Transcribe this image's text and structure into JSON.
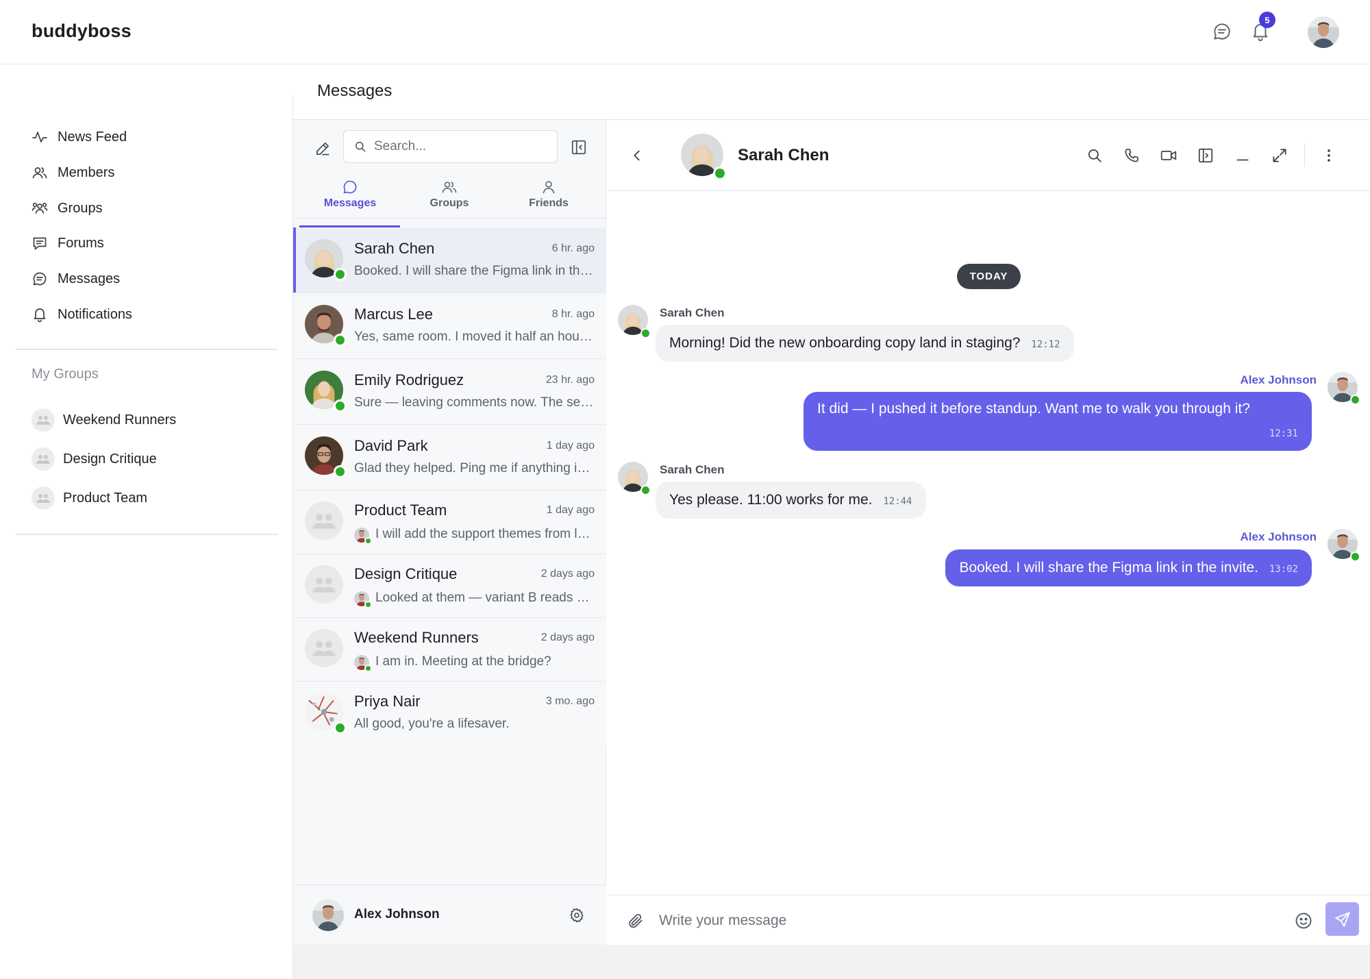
{
  "app": {
    "logo": "buddyboss"
  },
  "topbar": {
    "notification_count": "5"
  },
  "nav": {
    "items": [
      {
        "label": "News Feed",
        "icon": "activity-icon"
      },
      {
        "label": "Members",
        "icon": "members-icon"
      },
      {
        "label": "Groups",
        "icon": "groups-icon"
      },
      {
        "label": "Forums",
        "icon": "forums-icon"
      },
      {
        "label": "Messages",
        "icon": "messages-icon"
      },
      {
        "label": "Notifications",
        "icon": "bell-icon"
      }
    ],
    "my_groups_title": "My Groups",
    "groups": [
      {
        "label": "Weekend Runners"
      },
      {
        "label": "Design Critique"
      },
      {
        "label": "Product Team"
      }
    ]
  },
  "messages_page": {
    "title": "Messages"
  },
  "conv_panel": {
    "search_placeholder": "Search...",
    "tabs": [
      {
        "label": "Messages",
        "active": true
      },
      {
        "label": "Groups",
        "active": false
      },
      {
        "label": "Friends",
        "active": false
      }
    ],
    "conversations": [
      {
        "name": "Sarah Chen",
        "time": "6 hr. ago",
        "preview": "Booked. I will share the Figma link in the invite.",
        "selected": true,
        "kind": "person",
        "online": true
      },
      {
        "name": "Marcus Lee",
        "time": "8 hr. ago",
        "preview": "Yes, same room. I moved it half an hour later.",
        "selected": false,
        "kind": "person",
        "online": true
      },
      {
        "name": "Emily Rodriguez",
        "time": "23 hr. ago",
        "preview": "Sure — leaving comments now. The second section needs work.",
        "selected": false,
        "kind": "person",
        "online": true
      },
      {
        "name": "David Park",
        "time": "1 day ago",
        "preview": "Glad they helped. Ping me if anything is unclear.",
        "selected": false,
        "kind": "person",
        "online": true
      },
      {
        "name": "Product Team",
        "time": "1 day ago",
        "preview": "I will add the support themes from last week.",
        "selected": false,
        "kind": "group"
      },
      {
        "name": "Design Critique",
        "time": "2 days ago",
        "preview": "Looked at them — variant B reads cleaner to me.",
        "selected": false,
        "kind": "group"
      },
      {
        "name": "Weekend Runners",
        "time": "2 days ago",
        "preview": "I am in. Meeting at the bridge?",
        "selected": false,
        "kind": "group"
      },
      {
        "name": "Priya Nair",
        "time": "3 mo. ago",
        "preview": "All good, you're a lifesaver.",
        "selected": false,
        "kind": "person",
        "online": true
      }
    ],
    "self_name": "Alex Johnson"
  },
  "chat": {
    "title": "Sarah Chen",
    "day_label": "TODAY",
    "messages": [
      {
        "sender": "Sarah Chen",
        "text": "Morning! Did the new onboarding copy land in staging?",
        "time": "12:12",
        "mine": false
      },
      {
        "sender": "Alex Johnson",
        "text": "It did — I pushed it before standup. Want me to walk you through it?",
        "time": "12:31",
        "mine": true
      },
      {
        "sender": "Sarah Chen",
        "text": "Yes please. 11:00 works for me.",
        "time": "12:44",
        "mine": false
      },
      {
        "sender": "Alex Johnson",
        "text": "Booked. I will share the Figma link in the invite.",
        "time": "13:02",
        "mine": true
      }
    ],
    "composer_placeholder": "Write your message"
  },
  "colors": {
    "accent": "#6460ea",
    "online": "#2eaa2a",
    "badge": "#4b3bdb",
    "send_button": "#a8a6f4"
  }
}
